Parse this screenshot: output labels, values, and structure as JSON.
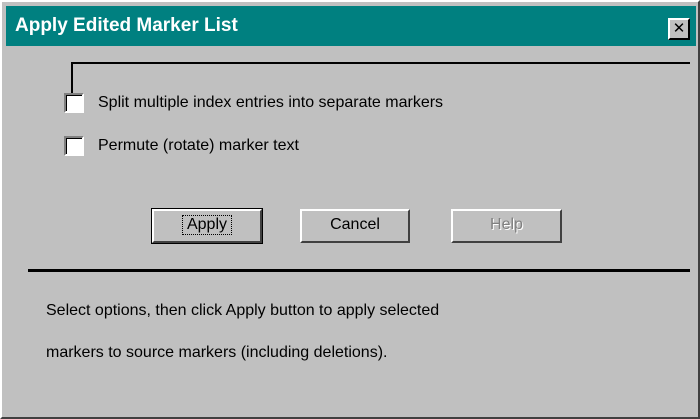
{
  "window": {
    "title": "Apply Edited Marker List",
    "close_glyph": "✕"
  },
  "options": [
    {
      "label": "Split multiple index entries into separate markers",
      "checked": false
    },
    {
      "label": "Permute (rotate) marker text",
      "checked": false
    }
  ],
  "buttons": {
    "apply": "Apply",
    "cancel": "Cancel",
    "help": "Help"
  },
  "help_text": {
    "line1": "Select options, then click Apply button to apply selected",
    "line2": "markers to source markers (including deletions)."
  },
  "colors": {
    "titlebar": "#008080",
    "face": "#c0c0c0"
  }
}
